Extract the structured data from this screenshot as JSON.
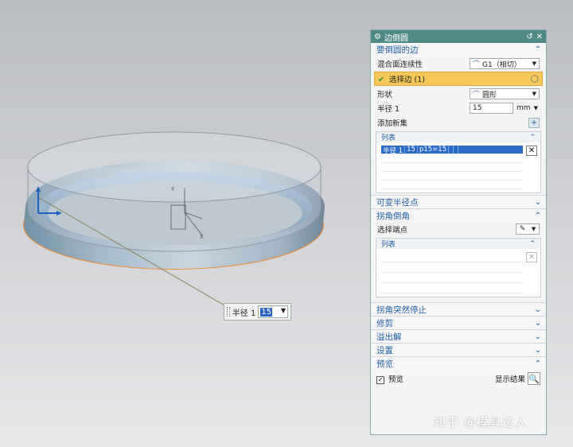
{
  "dialog": {
    "title": "边倒圆",
    "sections": {
      "edges": {
        "title": "要倒圆的边",
        "continuity_label": "混合面连续性",
        "continuity_value": "G1（相切）",
        "select_edge_label": "选择边 (1)",
        "shape_label": "形状",
        "shape_value": "圆形",
        "radius_label": "半径 1",
        "radius_value": "15",
        "radius_unit": "mm",
        "add_new_set_label": "添加新集",
        "list_label": "列表",
        "list_rows": [
          {
            "c1": "半径 1",
            "c2": "15",
            "c3": "p15=15"
          }
        ]
      },
      "variable_radius": {
        "title": "可变半径点"
      },
      "corner_setback": {
        "title": "拐角倒角",
        "select_endpoint_label": "选择端点",
        "list_label": "列表"
      },
      "corner_stop": {
        "title": "拐角突然停止"
      },
      "trim": {
        "title": "修剪"
      },
      "overflow": {
        "title": "溢出解"
      },
      "settings": {
        "title": "设置"
      },
      "preview": {
        "title": "预览",
        "preview_checkbox_label": "预览",
        "show_result_label": "显示结果"
      }
    }
  },
  "float_input": {
    "label": "半径 1",
    "value": "15"
  },
  "watermark": "知乎 @模具达人",
  "colors": {
    "titlebar": "#4f8a86",
    "section_text": "#1f5fa8",
    "selection_highlight": "#f4c95a",
    "list_selection": "#2a6ac9",
    "fillet_edge": "#f08a30"
  }
}
